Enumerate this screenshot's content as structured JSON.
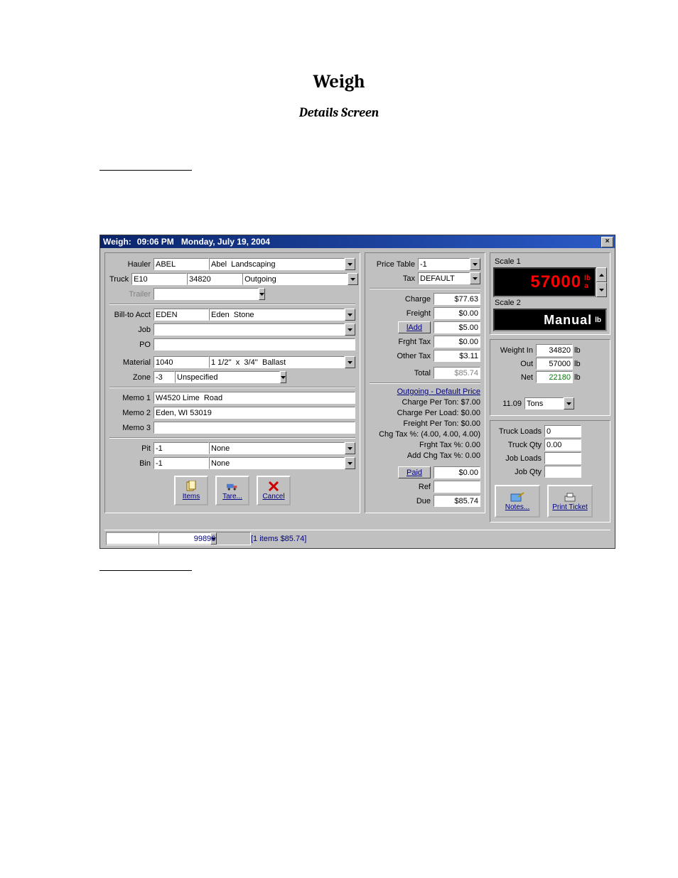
{
  "doc": {
    "title": "Weigh",
    "subtitle": "Details Screen"
  },
  "titlebar": {
    "caption": "Weigh:",
    "time": "09:06 PM",
    "date": "Monday, July 19, 2004"
  },
  "labels": {
    "hauler": "Hauler",
    "truck": "Truck",
    "trailer": "Trailer",
    "billto": "Bill-to Acct",
    "job": "Job",
    "po": "PO",
    "material": "Material",
    "zone": "Zone",
    "memo1": "Memo 1",
    "memo2": "Memo 2",
    "memo3": "Memo 3",
    "pit": "Pit",
    "bin": "Bin",
    "priceTable": "Price Table",
    "tax": "Tax",
    "charge": "Charge",
    "freight": "Freight",
    "addl": "lAdd",
    "frghtTax": "Frght Tax",
    "otherTax": "Other Tax",
    "total": "Total",
    "paid": "Paid",
    "ref": "Ref",
    "due": "Due",
    "scale1": "Scale 1",
    "scale2": "Scale 2",
    "weightIn": "Weight In",
    "weightOut": "Out",
    "weightNet": "Net",
    "truckLoads": "Truck Loads",
    "truckQty": "Truck Qty",
    "jobLoads": "Job Loads",
    "jobQty": "Job Qty",
    "units_lb": "lb",
    "units_a": "a"
  },
  "values": {
    "hauler_code": "ABEL",
    "hauler_name": "Abel  Landscaping",
    "truck_code": "E10",
    "truck_tare": "34820",
    "truck_dir": "Outgoing",
    "billto_code": "EDEN",
    "billto_name": "Eden  Stone",
    "job": "",
    "po": "",
    "material_code": "1040",
    "material_name": "1 1/2''  x  3/4''  Ballast",
    "zone_code": "-3",
    "zone_name": "Unspecified",
    "memo1": "W4520 Lime  Road",
    "memo2": "Eden, WI 53019",
    "memo3": "",
    "pit_code": "-1",
    "pit_name": "None",
    "bin_code": "-1",
    "bin_name": "None",
    "priceTable": "-1",
    "tax": "DEFAULT",
    "charge": "$77.63",
    "freight": "$0.00",
    "addl": "$5.00",
    "frghtTax": "$0.00",
    "otherTax": "$3.11",
    "total": "$85.74",
    "paid": "$0.00",
    "ref": "",
    "due": "$85.74",
    "scale1": "57000",
    "scale2": "Manual",
    "weightIn": "34820",
    "weightOut": "57000",
    "weightNet": "22180",
    "tons": "11.09",
    "tonsUnit": "Tons",
    "truckLoads": "0",
    "truckQty": "0.00",
    "status_num": "99896",
    "status_items": "[1 items  $85.74]"
  },
  "info": {
    "pricing_header": "Outgoing - Default Price",
    "chargePerTon": "Charge Per Ton:  $7.00",
    "chargePerLoad": "Charge Per Load:  $0.00",
    "freightPerTon": "Freight Per Ton:  $0.00",
    "chgTax": "Chg Tax %:   (4.00, 4.00, 4.00)",
    "frghtTaxPct": "Frght Tax %:  0.00",
    "addChgTax": "Add Chg Tax %:  0.00"
  },
  "buttons": {
    "items": "Items",
    "tare": "Tare...",
    "cancel": "Cancel",
    "notes": "Notes...",
    "printTicket": "Print Ticket"
  }
}
